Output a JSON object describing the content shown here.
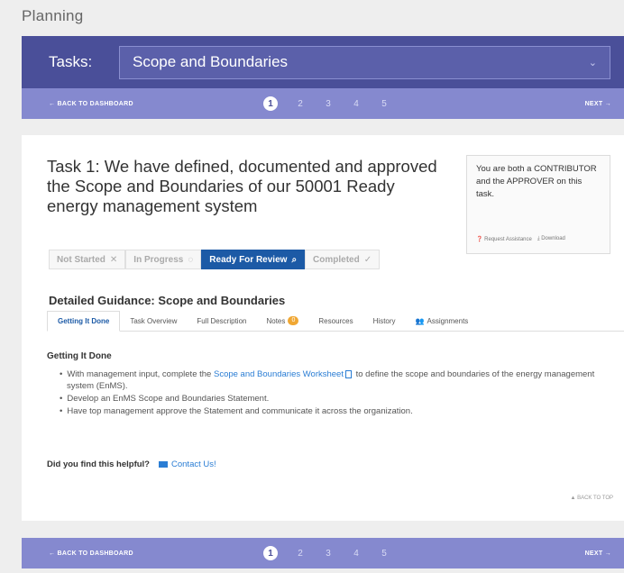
{
  "page": {
    "heading": "Planning"
  },
  "task_header": {
    "label": "Tasks:",
    "selected_task": "Scope and Boundaries",
    "chevron_icon": "chevron-down-icon"
  },
  "stepbar": {
    "back_label": "← BACK TO DASHBOARD",
    "next_label": "NEXT →",
    "steps": [
      "1",
      "2",
      "3",
      "4",
      "5"
    ],
    "active_step": "1"
  },
  "task": {
    "title": "Task 1: We have defined, documented and approved the Scope and Boundaries of our 50001 Ready energy management system",
    "role_message": "You are both a CONTRIBUTOR and the APPROVER on this task.",
    "request_assistance": "Request Assistance",
    "download": "Download"
  },
  "statuses": [
    {
      "label": "Not Started",
      "icon": "✕"
    },
    {
      "label": "In Progress",
      "icon": "◌"
    },
    {
      "label": "Ready For Review",
      "icon": "⌕"
    },
    {
      "label": "Completed",
      "icon": "✓"
    }
  ],
  "guidance": {
    "title": "Detailed Guidance: Scope and Boundaries",
    "tabs": [
      "Getting It Done",
      "Task Overview",
      "Full Description",
      "Notes",
      "Resources",
      "History",
      "Assignments"
    ],
    "notes_badge": "0",
    "section_heading": "Getting It Done",
    "bullet1_pre": "With management input, complete the ",
    "bullet1_link": "Scope and Boundaries Worksheet",
    "bullet1_post": " to define the scope and boundaries of the energy management system (EnMS).",
    "bullet2": "Develop an EnMS Scope and Boundaries Statement.",
    "bullet3": "Have top management approve the Statement and communicate it across the organization."
  },
  "helpful": {
    "question": "Did you find this helpful?",
    "contact": "Contact Us!"
  },
  "back_to_top": "BACK TO TOP",
  "colors": {
    "header": "#4a4f99",
    "stepbar": "#8589cf",
    "accent": "#1c5aa6",
    "link": "#2a7dd4"
  }
}
